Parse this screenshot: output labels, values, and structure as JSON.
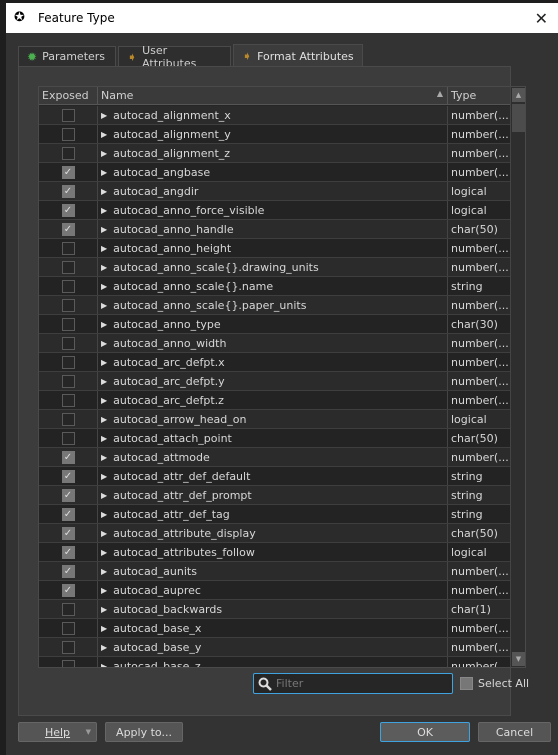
{
  "window": {
    "title": "Feature Type",
    "close_icon": "close-icon"
  },
  "tabs": [
    {
      "label": "Parameters",
      "icon": "gear-icon"
    },
    {
      "label": "User Attributes",
      "icon": "arrow-right-icon"
    },
    {
      "label": "Format Attributes",
      "icon": "arrow-right-icon",
      "active": true
    }
  ],
  "table": {
    "headers": {
      "exposed": "Exposed",
      "name": "Name",
      "type": "Type"
    },
    "rows": [
      {
        "exposed": false,
        "name": "autocad_alignment_x",
        "type": "number(..."
      },
      {
        "exposed": false,
        "name": "autocad_alignment_y",
        "type": "number(..."
      },
      {
        "exposed": false,
        "name": "autocad_alignment_z",
        "type": "number(..."
      },
      {
        "exposed": true,
        "name": "autocad_angbase",
        "type": "number(..."
      },
      {
        "exposed": true,
        "name": "autocad_angdir",
        "type": "logical"
      },
      {
        "exposed": true,
        "name": "autocad_anno_force_visible",
        "type": "logical"
      },
      {
        "exposed": true,
        "name": "autocad_anno_handle",
        "type": "char(50)"
      },
      {
        "exposed": false,
        "name": "autocad_anno_height",
        "type": "number(..."
      },
      {
        "exposed": false,
        "name": "autocad_anno_scale{}.drawing_units",
        "type": "number(..."
      },
      {
        "exposed": false,
        "name": "autocad_anno_scale{}.name",
        "type": "string"
      },
      {
        "exposed": false,
        "name": "autocad_anno_scale{}.paper_units",
        "type": "number(..."
      },
      {
        "exposed": false,
        "name": "autocad_anno_type",
        "type": "char(30)"
      },
      {
        "exposed": false,
        "name": "autocad_anno_width",
        "type": "number(..."
      },
      {
        "exposed": false,
        "name": "autocad_arc_defpt.x",
        "type": "number(..."
      },
      {
        "exposed": false,
        "name": "autocad_arc_defpt.y",
        "type": "number(..."
      },
      {
        "exposed": false,
        "name": "autocad_arc_defpt.z",
        "type": "number(..."
      },
      {
        "exposed": false,
        "name": "autocad_arrow_head_on",
        "type": "logical"
      },
      {
        "exposed": false,
        "name": "autocad_attach_point",
        "type": "char(50)"
      },
      {
        "exposed": true,
        "name": "autocad_attmode",
        "type": "number(..."
      },
      {
        "exposed": true,
        "name": "autocad_attr_def_default",
        "type": "string"
      },
      {
        "exposed": true,
        "name": "autocad_attr_def_prompt",
        "type": "string"
      },
      {
        "exposed": true,
        "name": "autocad_attr_def_tag",
        "type": "string"
      },
      {
        "exposed": true,
        "name": "autocad_attribute_display",
        "type": "char(50)"
      },
      {
        "exposed": true,
        "name": "autocad_attributes_follow",
        "type": "logical"
      },
      {
        "exposed": true,
        "name": "autocad_aunits",
        "type": "number(..."
      },
      {
        "exposed": true,
        "name": "autocad_auprec",
        "type": "number(..."
      },
      {
        "exposed": false,
        "name": "autocad_backwards",
        "type": "char(1)"
      },
      {
        "exposed": false,
        "name": "autocad_base_x",
        "type": "number(..."
      },
      {
        "exposed": false,
        "name": "autocad_base_y",
        "type": "number(..."
      },
      {
        "exposed": false,
        "name": "autocad_base_z",
        "type": "number(..."
      }
    ]
  },
  "filter": {
    "placeholder": "Filter",
    "value": ""
  },
  "select_all": {
    "label": "Select All"
  },
  "buttons": {
    "help": "Help",
    "apply": "Apply to...",
    "ok": "OK",
    "cancel": "Cancel"
  },
  "colors": {
    "accent": "#3fa3e0",
    "gear": "#4caf50",
    "arrow": "#b8862b"
  }
}
